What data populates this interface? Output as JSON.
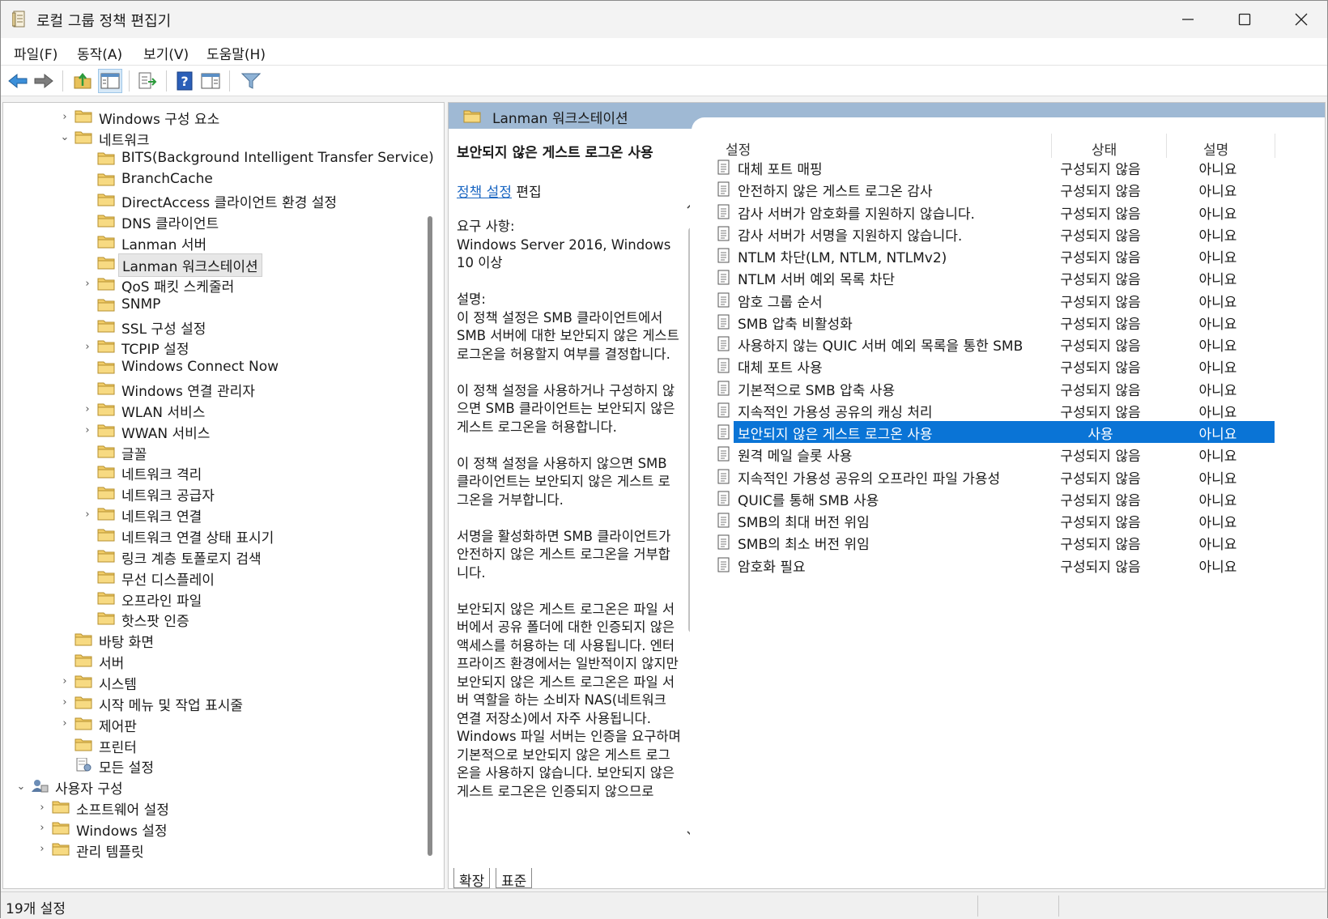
{
  "window": {
    "title": "로컬 그룹 정책 편집기",
    "minimize": "—",
    "maximize": "☐",
    "close": "✕"
  },
  "menu": [
    "파일(F)",
    "동작(A)",
    "보기(V)",
    "도움말(H)"
  ],
  "toolbar": {
    "icons": [
      "back-icon",
      "forward-icon",
      "up-folder-icon",
      "show-tree-icon",
      "export-list-icon",
      "help-icon",
      "properties-icon",
      "filter-icon"
    ],
    "help_glyph": "?"
  },
  "tree": {
    "items": [
      {
        "label": "Windows 구성 요소",
        "expander": "›"
      },
      {
        "label": "네트워크",
        "expander": "⌄"
      },
      {
        "label": "BITS(Background Intelligent Transfer Service)",
        "expander": ""
      },
      {
        "label": "BranchCache",
        "expander": ""
      },
      {
        "label": "DirectAccess 클라이언트 환경 설정",
        "expander": ""
      },
      {
        "label": "DNS 클라이언트",
        "expander": ""
      },
      {
        "label": "Lanman 서버",
        "expander": ""
      },
      {
        "label": "Lanman 워크스테이션",
        "expander": ""
      },
      {
        "label": "QoS 패킷 스케줄러",
        "expander": "›"
      },
      {
        "label": "SNMP",
        "expander": ""
      },
      {
        "label": "SSL 구성 설정",
        "expander": ""
      },
      {
        "label": "TCPIP 설정",
        "expander": "›"
      },
      {
        "label": "Windows Connect Now",
        "expander": ""
      },
      {
        "label": "Windows 연결 관리자",
        "expander": ""
      },
      {
        "label": "WLAN 서비스",
        "expander": "›"
      },
      {
        "label": "WWAN 서비스",
        "expander": "›"
      },
      {
        "label": "글꼴",
        "expander": ""
      },
      {
        "label": "네트워크 격리",
        "expander": ""
      },
      {
        "label": "네트워크 공급자",
        "expander": ""
      },
      {
        "label": "네트워크 연결",
        "expander": "›"
      },
      {
        "label": "네트워크 연결 상태 표시기",
        "expander": ""
      },
      {
        "label": "링크 계층 토폴로지 검색",
        "expander": ""
      },
      {
        "label": "무선 디스플레이",
        "expander": ""
      },
      {
        "label": "오프라인 파일",
        "expander": ""
      },
      {
        "label": "핫스팟 인증",
        "expander": ""
      },
      {
        "label": "바탕 화면",
        "expander": ""
      },
      {
        "label": "서버",
        "expander": ""
      },
      {
        "label": "시스템",
        "expander": "›"
      },
      {
        "label": "시작 메뉴 및 작업 표시줄",
        "expander": "›"
      },
      {
        "label": "제어판",
        "expander": "›"
      },
      {
        "label": "프린터",
        "expander": ""
      },
      {
        "label": "모든 설정",
        "expander": ""
      },
      {
        "label": "사용자 구성",
        "expander": "⌄"
      },
      {
        "label": "소프트웨어 설정",
        "expander": "›"
      },
      {
        "label": "Windows 설정",
        "expander": "›"
      },
      {
        "label": "관리 템플릿",
        "expander": "›"
      }
    ]
  },
  "header": {
    "title": "Lanman 워크스테이션"
  },
  "description": {
    "title": "보안되지 않은 게스트 로그온 사용",
    "edit_link": "정책 설정",
    "edit_suffix": " 편집",
    "body": "요구 사항:\nWindows Server 2016, Windows 10 이상\n\n설명:\n이 정책 설정은 SMB 클라이언트에서 SMB 서버에 대한 보안되지 않은 게스트 로그온을 허용할지 여부를 결정합니다.\n\n이 정책 설정을 사용하거나 구성하지 않으면 SMB 클라이언트는 보안되지 않은 게스트 로그온을 허용합니다.\n\n이 정책 설정을 사용하지 않으면 SMB 클라이언트는 보안되지 않은 게스트 로그온을 거부합니다.\n\n서명을 활성화하면 SMB 클라이언트가 안전하지 않은 게스트 로그온을 거부합니다.\n\n보안되지 않은 게스트 로그온은 파일 서버에서 공유 폴더에 대한 인증되지 않은 액세스를 허용하는 데 사용됩니다. 엔터프라이즈 환경에서는 일반적이지 않지만 보안되지 않은 게스트 로그온은 파일 서버 역할을 하는 소비자 NAS(네트워크 연결 저장소)에서 자주 사용됩니다. Windows 파일 서버는 인증을 요구하며 기본적으로 보안되지 않은 게스트 로그온을 사용하지 않습니다. 보안되지 않은 게스트 로그온은 인증되지 않으므로"
  },
  "list": {
    "columns": {
      "setting": "설정",
      "state": "상태",
      "comment": "설명"
    },
    "rows": [
      {
        "name": "대체 포트 매핑",
        "state": "구성되지 않음",
        "comment": "아니요"
      },
      {
        "name": "안전하지 않은 게스트 로그온 감사",
        "state": "구성되지 않음",
        "comment": "아니요"
      },
      {
        "name": "감사 서버가 암호화를 지원하지 않습니다.",
        "state": "구성되지 않음",
        "comment": "아니요"
      },
      {
        "name": "감사 서버가 서명을 지원하지 않습니다.",
        "state": "구성되지 않음",
        "comment": "아니요"
      },
      {
        "name": "NTLM 차단(LM, NTLM, NTLMv2)",
        "state": "구성되지 않음",
        "comment": "아니요"
      },
      {
        "name": "NTLM 서버 예외 목록 차단",
        "state": "구성되지 않음",
        "comment": "아니요"
      },
      {
        "name": "암호 그룹 순서",
        "state": "구성되지 않음",
        "comment": "아니요"
      },
      {
        "name": "SMB 압축 비활성화",
        "state": "구성되지 않음",
        "comment": "아니요"
      },
      {
        "name": "사용하지 않는 QUIC 서버 예외 목록을 통한 SMB",
        "state": "구성되지 않음",
        "comment": "아니요"
      },
      {
        "name": "대체 포트 사용",
        "state": "구성되지 않음",
        "comment": "아니요"
      },
      {
        "name": "기본적으로 SMB 압축 사용",
        "state": "구성되지 않음",
        "comment": "아니요"
      },
      {
        "name": "지속적인 가용성 공유의 캐싱 처리",
        "state": "구성되지 않음",
        "comment": "아니요"
      },
      {
        "name": "보안되지 않은 게스트 로그온 사용",
        "state": "사용",
        "comment": "아니요"
      },
      {
        "name": "원격 메일 슬롯 사용",
        "state": "구성되지 않음",
        "comment": "아니요"
      },
      {
        "name": "지속적인 가용성 공유의 오프라인 파일 가용성",
        "state": "구성되지 않음",
        "comment": "아니요"
      },
      {
        "name": "QUIC를 통해 SMB 사용",
        "state": "구성되지 않음",
        "comment": "아니요"
      },
      {
        "name": "SMB의 최대 버전 위임",
        "state": "구성되지 않음",
        "comment": "아니요"
      },
      {
        "name": "SMB의 최소 버전 위임",
        "state": "구성되지 않음",
        "comment": "아니요"
      },
      {
        "name": "암호화 필요",
        "state": "구성되지 않음",
        "comment": "아니요"
      }
    ]
  },
  "tabs": [
    "확장",
    "표준"
  ],
  "status": {
    "text": "19개 설정"
  },
  "colors": {
    "selection": "#0a74d6",
    "header": "#9fb9d4",
    "link": "#1a66c2"
  }
}
